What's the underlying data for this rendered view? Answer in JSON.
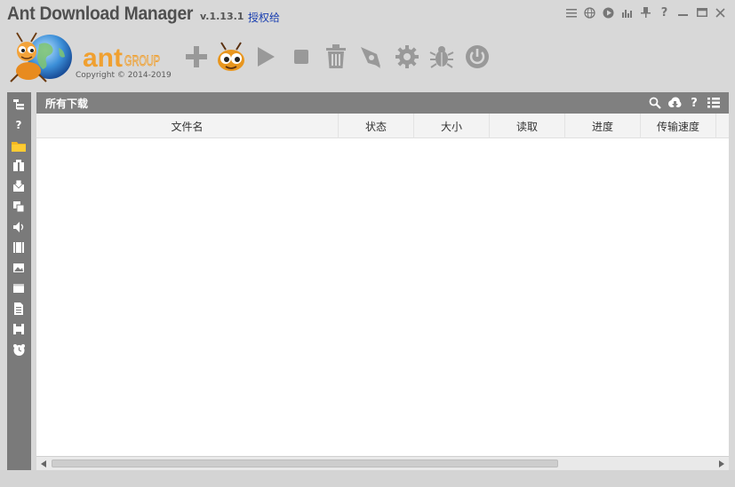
{
  "title": {
    "app_name": "Ant Download Manager",
    "version": "v.1.13.1",
    "license_link": "授权给"
  },
  "logo": {
    "brand": "ant",
    "group": "GROUP",
    "copyright": "Copyright © 2014-2019"
  },
  "window_controls": [
    "menu-icon",
    "globe-icon",
    "play-circle-icon",
    "equalizer-icon",
    "pin-icon",
    "help-icon",
    "minimize-icon",
    "restore-icon",
    "close-icon"
  ],
  "toolbar": [
    "add-icon",
    "ant-mascot-icon",
    "play-icon",
    "stop-icon",
    "delete-icon",
    "rocket-icon",
    "settings-icon",
    "bug-icon",
    "power-icon"
  ],
  "sidebar": [
    "tree-icon",
    "unknown-icon",
    "folder-icon",
    "archive-icon",
    "download-box-icon",
    "copy-icon",
    "audio-icon",
    "video-icon",
    "image-icon",
    "window-icon",
    "document-icon",
    "program-icon",
    "alarm-icon"
  ],
  "panel": {
    "title": "所有下载",
    "tools": [
      "search-icon",
      "cloud-download-icon",
      "help-icon",
      "list-view-icon"
    ]
  },
  "columns": [
    {
      "label": "文件名"
    },
    {
      "label": "状态"
    },
    {
      "label": "大小"
    },
    {
      "label": "读取"
    },
    {
      "label": "进度"
    },
    {
      "label": "传输速度"
    }
  ],
  "colors": {
    "accent_orange": "#f0a030",
    "panel_gray": "#808080",
    "sidebar_gray": "#7a7a7a",
    "toolbar_icon": "#9a9a9a",
    "link_blue": "#1a3fb0"
  }
}
